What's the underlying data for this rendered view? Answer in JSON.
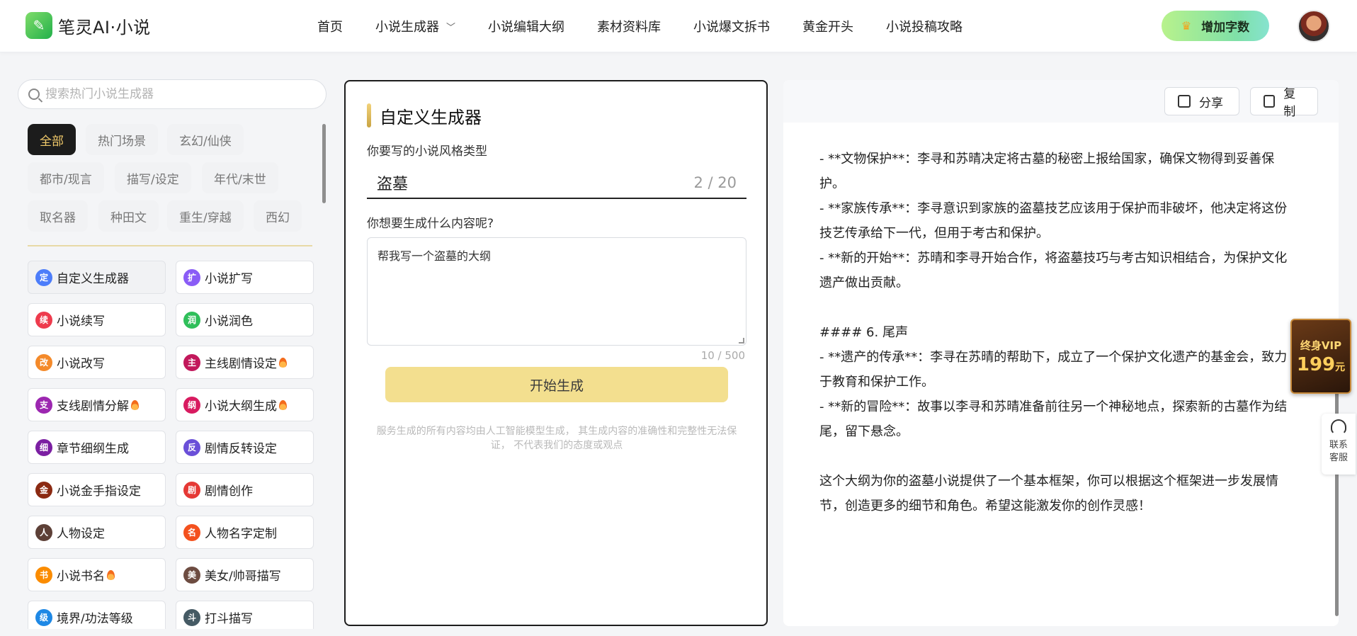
{
  "header": {
    "logo_icon": "leaf-icon",
    "logo_text": "笔灵AI·小说",
    "nav": [
      {
        "label": "首页"
      },
      {
        "label": "小说生成器",
        "has_dropdown": true
      },
      {
        "label": "小说编辑大纲"
      },
      {
        "label": "素材资料库"
      },
      {
        "label": "小说爆文拆书"
      },
      {
        "label": "黄金开头"
      },
      {
        "label": "小说投稿攻略"
      }
    ],
    "vip_button": "增加字数",
    "avatar_icon": "user-avatar"
  },
  "sidebar": {
    "search_placeholder": "搜索热门小说生成器",
    "tags": [
      "全部",
      "热门场景",
      "玄幻/仙侠",
      "都市/现言",
      "描写/设定",
      "年代/末世",
      "取名器",
      "种田文",
      "重生/穿越",
      "西幻"
    ],
    "active_tag": "全部",
    "tools": [
      {
        "label": "自定义生成器",
        "icon_char": "定",
        "color": "#4c7dfa",
        "selected": true,
        "hot": false
      },
      {
        "label": "小说扩写",
        "icon_char": "扩",
        "color": "#8a5cf6",
        "hot": false
      },
      {
        "label": "小说续写",
        "icon_char": "续",
        "color": "#ee3b4d",
        "hot": false
      },
      {
        "label": "小说润色",
        "icon_char": "润",
        "color": "#2fbf5a",
        "hot": false
      },
      {
        "label": "小说改写",
        "icon_char": "改",
        "color": "#f48a2a",
        "hot": false
      },
      {
        "label": "主线剧情设定",
        "icon_char": "主",
        "color": "#c2185b",
        "hot": true
      },
      {
        "label": "支线剧情分解",
        "icon_char": "支",
        "color": "#9c27b0",
        "hot": true
      },
      {
        "label": "小说大纲生成",
        "icon_char": "纲",
        "color": "#d81b60",
        "hot": true
      },
      {
        "label": "章节细纲生成",
        "icon_char": "细",
        "color": "#7b1fa2",
        "hot": false
      },
      {
        "label": "剧情反转设定",
        "icon_char": "反",
        "color": "#6a4fd8",
        "hot": false
      },
      {
        "label": "小说金手指设定",
        "icon_char": "金",
        "color": "#8b2a12",
        "hot": false
      },
      {
        "label": "剧情创作",
        "icon_char": "剧",
        "color": "#e53935",
        "hot": false
      },
      {
        "label": "人物设定",
        "icon_char": "人",
        "color": "#5d4037",
        "hot": false
      },
      {
        "label": "人物名字定制",
        "icon_char": "名",
        "color": "#f4511e",
        "hot": false
      },
      {
        "label": "小说书名",
        "icon_char": "书",
        "color": "#fb8c00",
        "hot": true
      },
      {
        "label": "美女/帅哥描写",
        "icon_char": "美",
        "color": "#6d4c41",
        "hot": false
      },
      {
        "label": "境界/功法等级",
        "icon_char": "级",
        "color": "#1e88e5",
        "hot": false
      },
      {
        "label": "打斗描写",
        "icon_char": "斗",
        "color": "#455a64",
        "hot": false
      }
    ]
  },
  "generator": {
    "title": "自定义生成器",
    "style_label": "你要写的小说风格类型",
    "style_value": "盗墓",
    "style_count": "2 / 20",
    "content_label": "你想要生成什么内容呢?",
    "content_value": "帮我写一个盗墓的大纲",
    "content_count": "10 / 500",
    "generate_button": "开始生成",
    "disclaimer": "服务生成的所有内容均由人工智能模型生成， 其生成内容的准确性和完整性无法保证， 不代表我们的态度或观点"
  },
  "output": {
    "share_button": "分享",
    "copy_button": "复制",
    "lines": [
      "- **文物保护**：李寻和苏晴决定将古墓的秘密上报给国家，确保文物得到妥善保护。",
      "- **家族传承**：李寻意识到家族的盗墓技艺应该用于保护而非破坏，他决定将这份技艺传承给下一代，但用于考古和保护。",
      "- **新的开始**：苏晴和李寻开始合作，将盗墓技巧与考古知识相结合，为保护文化遗产做出贡献。",
      "",
      "#### 6. 尾声",
      "- **遗产的传承**：李寻在苏晴的帮助下，成立了一个保护文化遗产的基金会，致力于教育和保护工作。",
      "- **新的冒险**：故事以李寻和苏晴准备前往另一个神秘地点，探索新的古墓作为结尾，留下悬念。",
      "",
      "这个大纲为你的盗墓小说提供了一个基本框架，你可以根据这个框架进一步发展情节，创造更多的细节和角色。希望这能激发你的创作灵感！"
    ]
  },
  "floating": {
    "vip_badge_line1": "终身VIP",
    "vip_badge_price": "199",
    "vip_badge_unit": "元",
    "service_label_1": "联系",
    "service_label_2": "客服"
  }
}
